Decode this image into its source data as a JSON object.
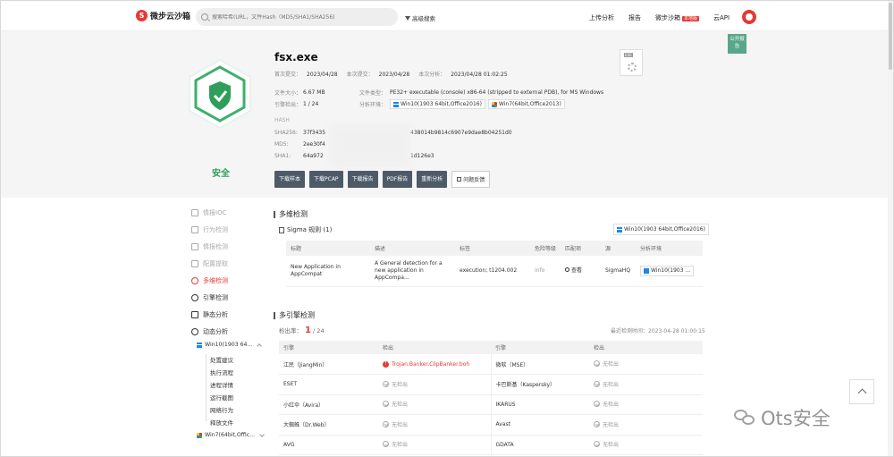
{
  "topbar": {
    "logo": "微步云沙箱",
    "search_placeholder": "搜索哈希(URL，文件Hash（MD5/SHA1/SHA256)",
    "advanced_search": "高级搜索",
    "nav": [
      "上传分析",
      "报告",
      "微步沙箱",
      "云API"
    ],
    "badge": "本地版",
    "public_report": "公开报告"
  },
  "file": {
    "name": "fsx.exe",
    "verdict": "安全",
    "first_submit_label": "首次提交：",
    "first_submit": "2023/04/28",
    "last_submit_label": "本次提交：",
    "last_submit": "2023/04/28",
    "last_analysis_label": "本次分析：",
    "last_analysis": "2023/04/28 01:02:25",
    "size_label": "文件大小：",
    "size": "6.67 MB",
    "type_label": "文件类型：",
    "type": "PE32+ executable (console) x86-64 (stripped to external PDB), for MS Windows",
    "engine_label": "引擎检出：",
    "engine_count": "1 / 24",
    "env_label": "分析环境：",
    "env1": "Win10(1903 64bit,Office2016)",
    "env2": "Win7(64bit,Office2013)",
    "exe_tag": "EXE"
  },
  "hash": {
    "title": "HASH",
    "sha256_label": "SHA256:",
    "sha256": "37f3435",
    "sha256_tail": "438014b9814c6907e9dae8b04251d0",
    "md5_label": "MD5:",
    "md5": "2ee30f4",
    "sha1_label": "SHA1:",
    "sha1": "64a972",
    "sha1_tail": "1d126e3"
  },
  "actions": [
    "下载样本",
    "下载PCAP",
    "下载报告",
    "PDF报告",
    "重新分析",
    "问题反馈"
  ],
  "sidebar": {
    "items": [
      "情报IOC",
      "行为检测",
      "情报检测",
      "配置提取",
      "多维检测",
      "引擎检测",
      "静态分析",
      "动态分析"
    ],
    "env1": "Win10(1903 64...",
    "sub_links": [
      "处置建议",
      "执行流程",
      "进程详情",
      "运行截图",
      "网络行为",
      "释放文件"
    ],
    "env2": "Win7(64bit,Offic..."
  },
  "multi": {
    "title": "多维检测",
    "sigma_title": "Sigma 规则 (1)",
    "env": "Win10(1903 64bit,Office2016)",
    "headers": [
      "标题",
      "描述",
      "标签",
      "危险等级",
      "匹配项",
      "源",
      "分析环境"
    ],
    "row": {
      "title": "New Application in AppCompat",
      "desc": "A General detection for a new application in AppCompa...",
      "tags": "execution; t1204.002",
      "level": "info",
      "match": "查看",
      "source": "SigmaHQ",
      "env": "Win10(1903 ..."
    }
  },
  "engines": {
    "title": "多引擎检测",
    "detect_label": "检出率：",
    "detect_num": "1",
    "detect_total": "/ 24",
    "last_time": "最近检测时间：2023-04-28 01:00:15",
    "headers": [
      "引擎",
      "检出",
      "引擎",
      "检出"
    ],
    "rows": [
      {
        "e1": "江民（JiangMin）",
        "r1": "Trojan.Banker.ClipBanker.boh",
        "r1_bad": true,
        "e2": "微软（MSE）",
        "r2": "无检出"
      },
      {
        "e1": "ESET",
        "r1": "无检出",
        "r1_bad": false,
        "e2": "卡巴斯基（Kaspersky）",
        "r2": "无检出"
      },
      {
        "e1": "小红伞（Avira）",
        "r1": "无检出",
        "r1_bad": false,
        "e2": "IKARUS",
        "r2": "无检出"
      },
      {
        "e1": "大蜘蛛（Dr.Web）",
        "r1": "无检出",
        "r1_bad": false,
        "e2": "Avast",
        "r2": "无检出"
      },
      {
        "e1": "AVG",
        "r1": "无检出",
        "r1_bad": false,
        "e2": "GDATA",
        "r2": "无检出"
      }
    ]
  },
  "watermark": "Ots安全",
  "colors": {
    "accent": "#e53935",
    "safe": "#2e9e5b",
    "button": "#4f5a68"
  }
}
